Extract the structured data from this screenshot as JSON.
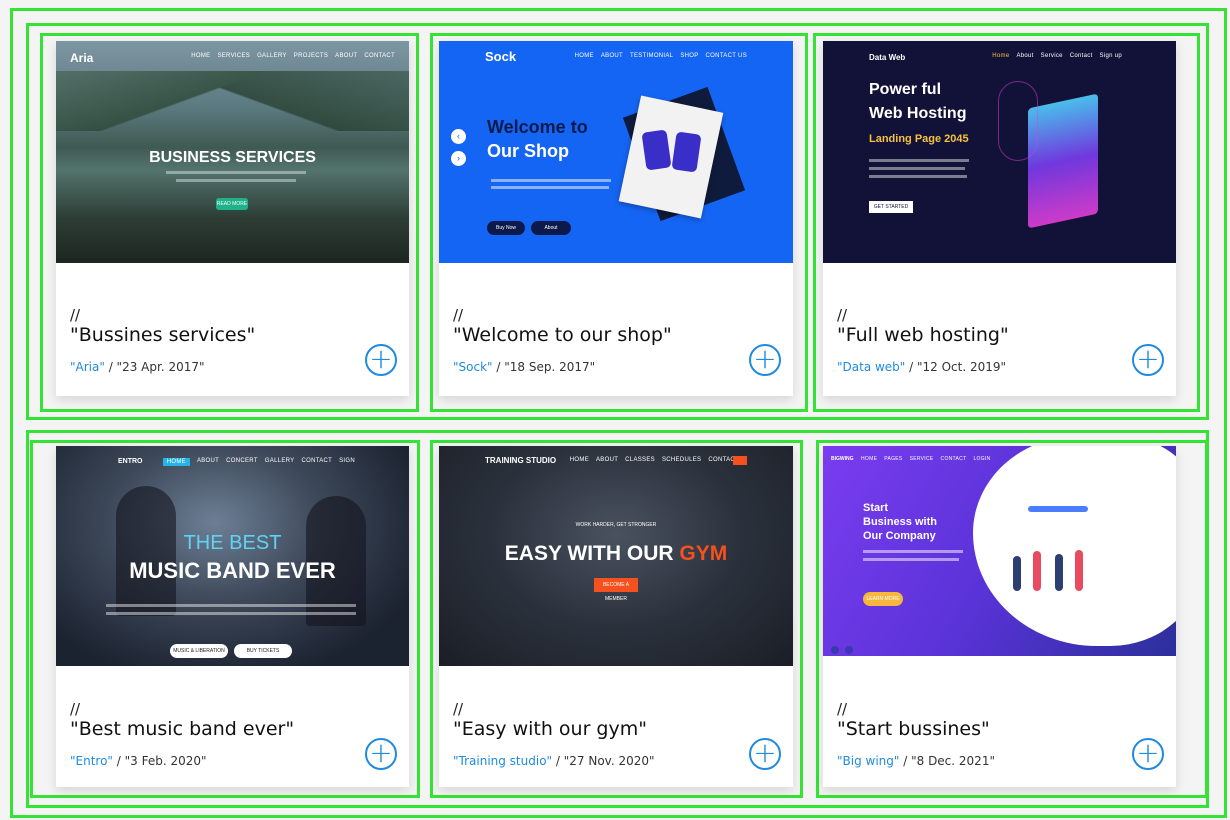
{
  "cards": [
    {
      "slashes": "//",
      "title": "\"Bussines services\"",
      "brand": "\"Aria\"",
      "separator": " / ",
      "date": "\"23 Apr. 2017\"",
      "plus": "+",
      "site": {
        "logo": "Aria",
        "nav": [
          "HOME",
          "SERVICES",
          "GALLERY",
          "PROJECTS",
          "ABOUT",
          "CONTACT"
        ],
        "hero": "BUSINESS SERVICES",
        "cta": "READ MORE"
      }
    },
    {
      "slashes": "//",
      "title": "\"Welcome to our shop\"",
      "brand": "\"Sock\"",
      "separator": " / ",
      "date": "\"18 Sep. 2017\"",
      "plus": "+",
      "site": {
        "logo": "Sock",
        "nav": [
          "HOME",
          "ABOUT",
          "TESTIMONIAL",
          "SHOP",
          "CONTACT US"
        ],
        "hero_line1": "Welcome to",
        "hero_line2": "Our Shop",
        "btn1": "Buy Now",
        "btn2": "About"
      }
    },
    {
      "slashes": "//",
      "title": "\"Full web hosting\"",
      "brand": "\"Data web\"",
      "separator": " / ",
      "date": "\"12 Oct. 2019\"",
      "plus": "+",
      "site": {
        "logo": "Data Web",
        "nav": [
          "Home",
          "About",
          "Service",
          "Contact",
          "Sign up"
        ],
        "hero_line1": "Power ful",
        "hero_line2": "Web Hosting",
        "hero_line3": "Landing Page 2045",
        "cta": "GET STARTED"
      }
    },
    {
      "slashes": "//",
      "title": "\"Best music band ever\"",
      "brand": "\"Entro\"",
      "separator": " / ",
      "date": "\"3 Feb. 2020\"",
      "plus": "+",
      "site": {
        "logo": "ENTRO",
        "nav": [
          "HOME",
          "ABOUT",
          "CONCERT",
          "GALLERY",
          "CONTACT",
          "SIGN"
        ],
        "hero_line1": "THE BEST",
        "hero_line2": "MUSIC BAND EVER",
        "btn1": "MUSIC & LIBERATION",
        "btn2": "BUY TICKETS"
      }
    },
    {
      "slashes": "//",
      "title": "\"Easy with our gym\"",
      "brand": "\"Training studio\"",
      "separator": " / ",
      "date": "\"27 Nov. 2020\"",
      "plus": "+",
      "site": {
        "logo": "TRAINING STUDIO",
        "nav": [
          "HOME",
          "ABOUT",
          "CLASSES",
          "SCHEDULES",
          "CONTACT"
        ],
        "tagline": "WORK HARDER, GET STRONGER",
        "hero_a": "EASY WITH OUR ",
        "hero_b": "GYM",
        "cta": "BECOME A MEMBER"
      }
    },
    {
      "slashes": "//",
      "title": "\"Start bussines\"",
      "brand": "\"Big wing\"",
      "separator": " / ",
      "date": "\"8 Dec. 2021\"",
      "plus": "+",
      "site": {
        "logo": "BIGWING",
        "nav": [
          "HOME",
          "PAGES",
          "SERVICE",
          "CONTACT",
          "LOGIN"
        ],
        "hero_line1": "Start",
        "hero_line2": "Business with",
        "hero_line3": "Our Company",
        "cta": "LEARN MORE"
      }
    }
  ],
  "colors": {
    "highlight": "#34e334",
    "link": "#1f8ae0",
    "sock_bg": "#1565f5",
    "dataweb_bg": "#121238",
    "gym_accent": "#f4511e",
    "bigwing_purple": "#6a3de8"
  }
}
